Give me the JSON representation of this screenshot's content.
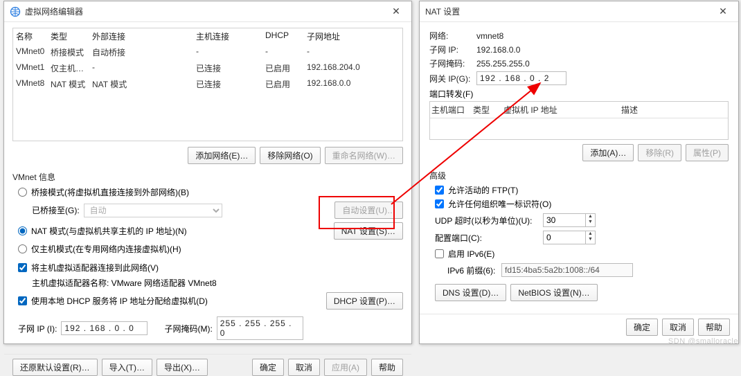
{
  "vne": {
    "title": "虚拟网络编辑器",
    "cols": {
      "name": "名称",
      "type": "类型",
      "ext": "外部连接",
      "host": "主机连接",
      "dhcp": "DHCP",
      "sub": "子网地址"
    },
    "rows": [
      {
        "name": "VMnet0",
        "type": "桥接模式",
        "ext": "自动桥接",
        "host": "-",
        "dhcp": "-",
        "sub": "-"
      },
      {
        "name": "VMnet1",
        "type": "仅主机…",
        "ext": "-",
        "host": "已连接",
        "dhcp": "已启用",
        "sub": "192.168.204.0"
      },
      {
        "name": "VMnet8",
        "type": "NAT 模式",
        "ext": "NAT 模式",
        "host": "已连接",
        "dhcp": "已启用",
        "sub": "192.168.0.0"
      }
    ],
    "btn_add": "添加网络(E)…",
    "btn_remove": "移除网络(O)",
    "btn_rename": "重命名网络(W)…",
    "section": "VMnet 信息",
    "radio_bridge": "桥接模式(将虚拟机直接连接到外部网络)(B)",
    "bridge_to": "已桥接至(G):",
    "bridge_sel": "自动",
    "btn_autoset": "自动设置(U)…",
    "radio_nat": "NAT 模式(与虚拟机共享主机的 IP 地址)(N)",
    "btn_natset": "NAT 设置(S)…",
    "radio_host": "仅主机模式(在专用网络内连接虚拟机)(H)",
    "chk_conn": "将主机虚拟适配器连接到此网络(V)",
    "adapter_line": "主机虚拟适配器名称: VMware 网络适配器 VMnet8",
    "chk_dhcp": "使用本地 DHCP 服务将 IP 地址分配给虚拟机(D)",
    "btn_dhcpset": "DHCP 设置(P)…",
    "subnet_lbl": "子网 IP (I):",
    "subnet": "192 . 168 .  0  .  0",
    "mask_lbl": "子网掩码(M):",
    "mask": "255 . 255 . 255 .  0",
    "btn_restore": "还原默认设置(R)…",
    "btn_import": "导入(T)…",
    "btn_export": "导出(X)…",
    "btn_ok": "确定",
    "btn_cancel": "取消",
    "btn_apply": "应用(A)",
    "btn_help": "帮助"
  },
  "nat": {
    "title": "NAT 设置",
    "net_lbl": "网络:",
    "net": "vmnet8",
    "sub_lbl": "子网 IP:",
    "sub": "192.168.0.0",
    "mask_lbl": "子网掩码:",
    "mask": "255.255.255.0",
    "gw_lbl": "网关 IP(G):",
    "gw": "192 . 168 .  0  .  2",
    "pf_lbl": "端口转发(F)",
    "pf_cols": {
      "hport": "主机端口",
      "type": "类型",
      "vip": "虚拟机 IP 地址",
      "desc": "描述"
    },
    "btn_add": "添加(A)…",
    "btn_remove": "移除(R)",
    "btn_prop": "属性(P)",
    "adv": "高级",
    "chk_ftp": "允许活动的 FTP(T)",
    "chk_ftp_on": true,
    "chk_org": "允许任何组织唯一标识符(O)",
    "chk_org_on": true,
    "udp_lbl": "UDP 超时(以秒为单位)(U):",
    "udp": "30",
    "cfg_lbl": "配置端口(C):",
    "cfg": "0",
    "chk_ipv6": "启用 IPv6(E)",
    "chk_ipv6_on": false,
    "ipv6_lbl": "IPv6 前缀(6):",
    "ipv6": "fd15:4ba5:5a2b:1008::/64",
    "btn_dns": "DNS 设置(D)…",
    "btn_netbios": "NetBIOS 设置(N)…",
    "btn_ok": "确定",
    "btn_cancel": "取消",
    "btn_help": "帮助"
  },
  "watermark": "SDN @smalloracle"
}
